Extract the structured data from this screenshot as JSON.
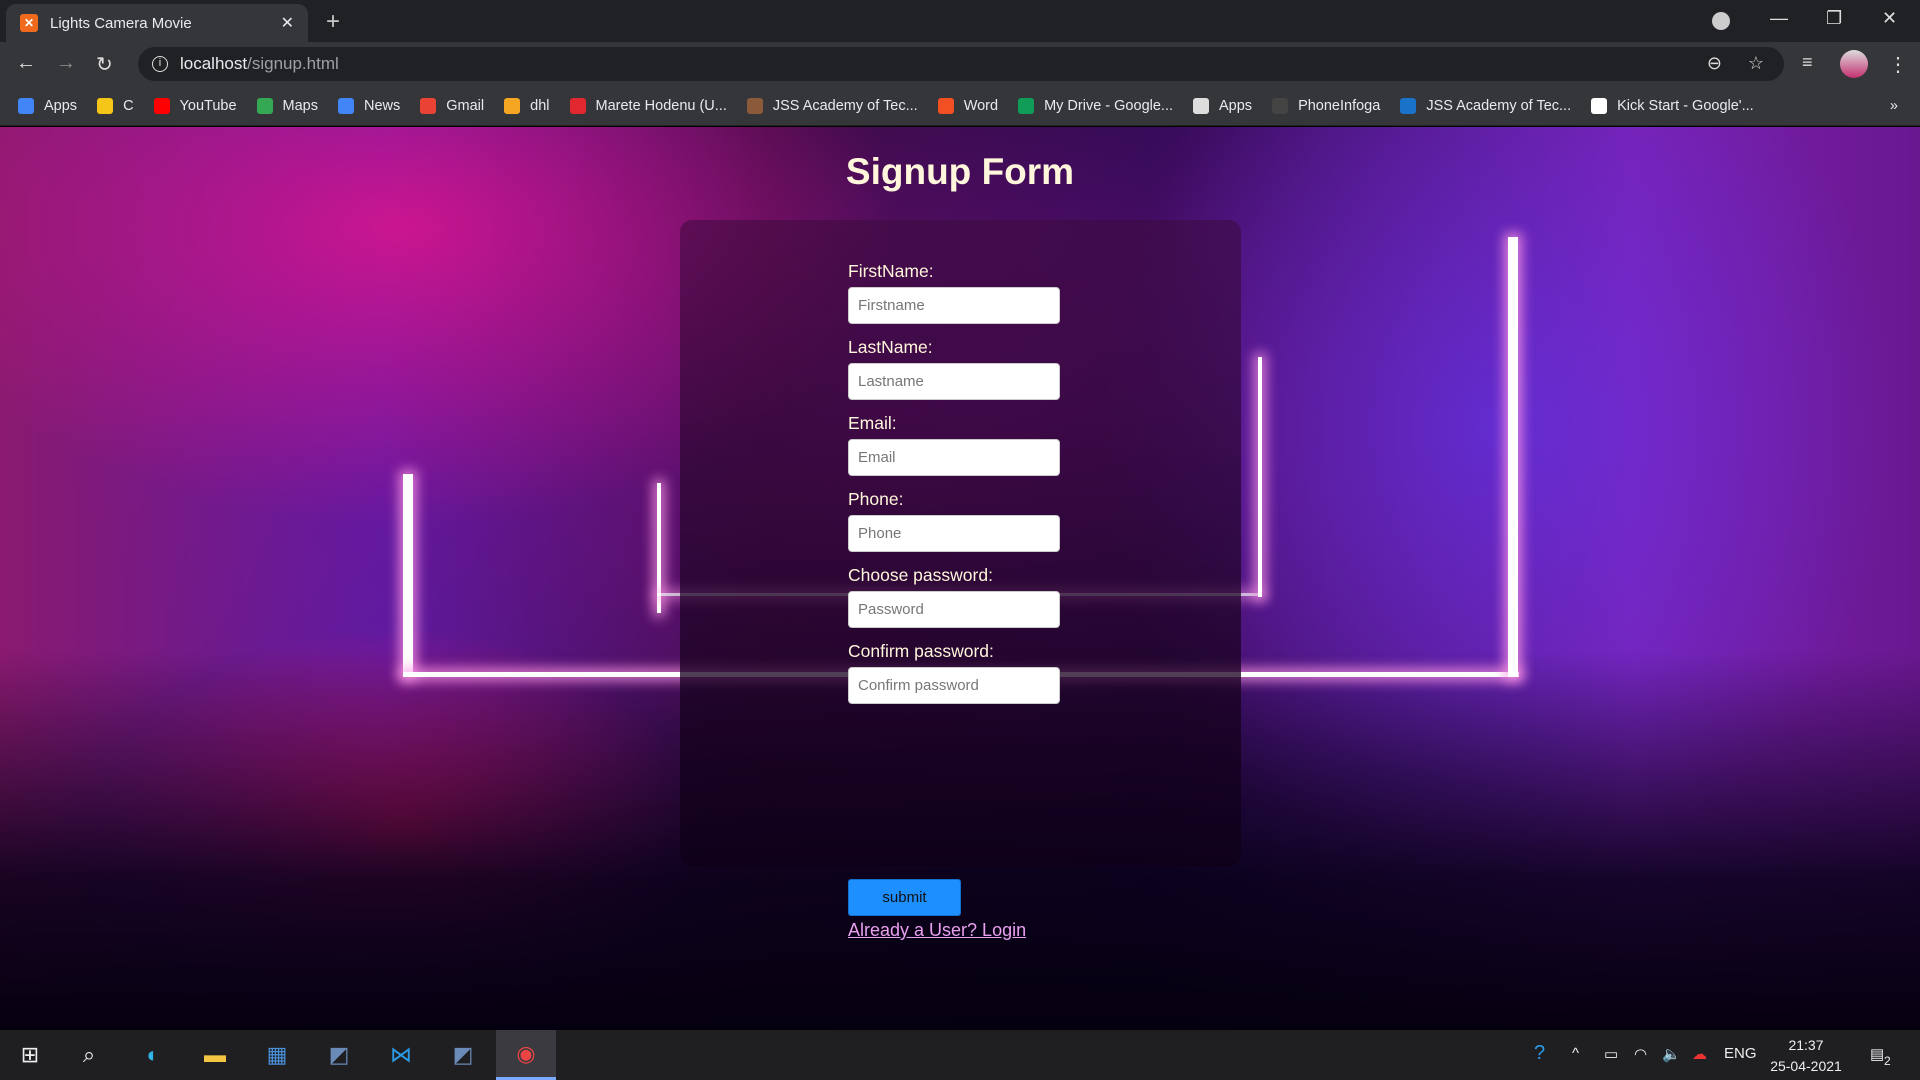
{
  "browser": {
    "tab_title": "Lights Camera Movie",
    "url_host": "localhost",
    "url_path": "/signup.html",
    "bookmarks": [
      {
        "label": "Apps",
        "icon": "apps-grid-icon",
        "color": "#4285f4"
      },
      {
        "label": "C",
        "icon": "codechef-icon",
        "color": "#f5c518"
      },
      {
        "label": "YouTube",
        "icon": "youtube-icon",
        "color": "#ff0000"
      },
      {
        "label": "Maps",
        "icon": "maps-icon",
        "color": "#34a853"
      },
      {
        "label": "News",
        "icon": "news-icon",
        "color": "#4285f4"
      },
      {
        "label": "Gmail",
        "icon": "gmail-icon",
        "color": "#ea4335"
      },
      {
        "label": "dhl",
        "icon": "dhl-icon",
        "color": "#f5a623"
      },
      {
        "label": "Marete Hodenu (U...",
        "icon": "marete-icon",
        "color": "#e0282e"
      },
      {
        "label": "JSS Academy of Tec...",
        "icon": "jss-icon",
        "color": "#8a5a3a"
      },
      {
        "label": "Word",
        "icon": "microsoft-icon",
        "color": "#f25022"
      },
      {
        "label": "My Drive - Google...",
        "icon": "drive-icon",
        "color": "#0f9d58"
      },
      {
        "label": "Apps",
        "icon": "apps-grid-icon",
        "color": "#dddddd"
      },
      {
        "label": "PhoneInfoga",
        "icon": "fingerprint-icon",
        "color": "#444444"
      },
      {
        "label": "JSS Academy of Tec...",
        "icon": "s-icon",
        "color": "#1a73c8"
      },
      {
        "label": "Kick Start - Google'...",
        "icon": "google-icon",
        "color": "#ffffff"
      }
    ],
    "more": "»"
  },
  "page": {
    "title": "Signup Form",
    "fields": [
      {
        "label": "FirstName:",
        "placeholder": "Firstname",
        "type": "text"
      },
      {
        "label": "LastName:",
        "placeholder": "Lastname",
        "type": "text"
      },
      {
        "label": "Email:",
        "placeholder": "Email",
        "type": "email"
      },
      {
        "label": "Phone:",
        "placeholder": "Phone",
        "type": "tel"
      },
      {
        "label": "Choose password:",
        "placeholder": "Password",
        "type": "password"
      },
      {
        "label": "Confirm password:",
        "placeholder": "Confirm password",
        "type": "password"
      }
    ],
    "submit": "submit",
    "login_link": "Already a User? Login"
  },
  "taskbar": {
    "lang": "ENG",
    "time": "21:37",
    "date": "25-04-2021",
    "notifications": "2"
  }
}
